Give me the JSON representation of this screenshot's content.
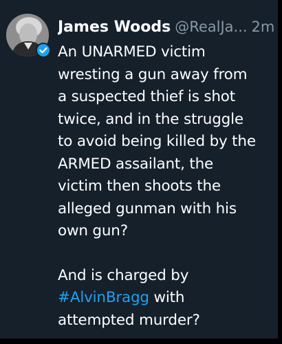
{
  "tweet": {
    "author": {
      "name": "James Woods",
      "handle": "@RealJa...",
      "avatar_icon": "avatar-portrait",
      "verified_icon": "verified-badge-icon"
    },
    "time": "2m",
    "body": {
      "paragraph1": {
        "lines": [
          "An UNARMED victim",
          "wresting a gun away from",
          "a suspected thief is shot",
          "twice, and in the struggle",
          "to avoid being killed by the",
          "ARMED assailant, the",
          "victim then shoots the",
          "alleged gunman with his",
          "own gun?"
        ]
      },
      "paragraph2": {
        "line1": "And is charged by",
        "hashtag": "#AlvinBragg",
        "line2_rest": " with",
        "line3": "attempted murder?"
      }
    },
    "colors": {
      "background": "#15202b",
      "text": "#ffffff",
      "secondary": "#8899a6",
      "accent": "#1da1f2"
    }
  }
}
